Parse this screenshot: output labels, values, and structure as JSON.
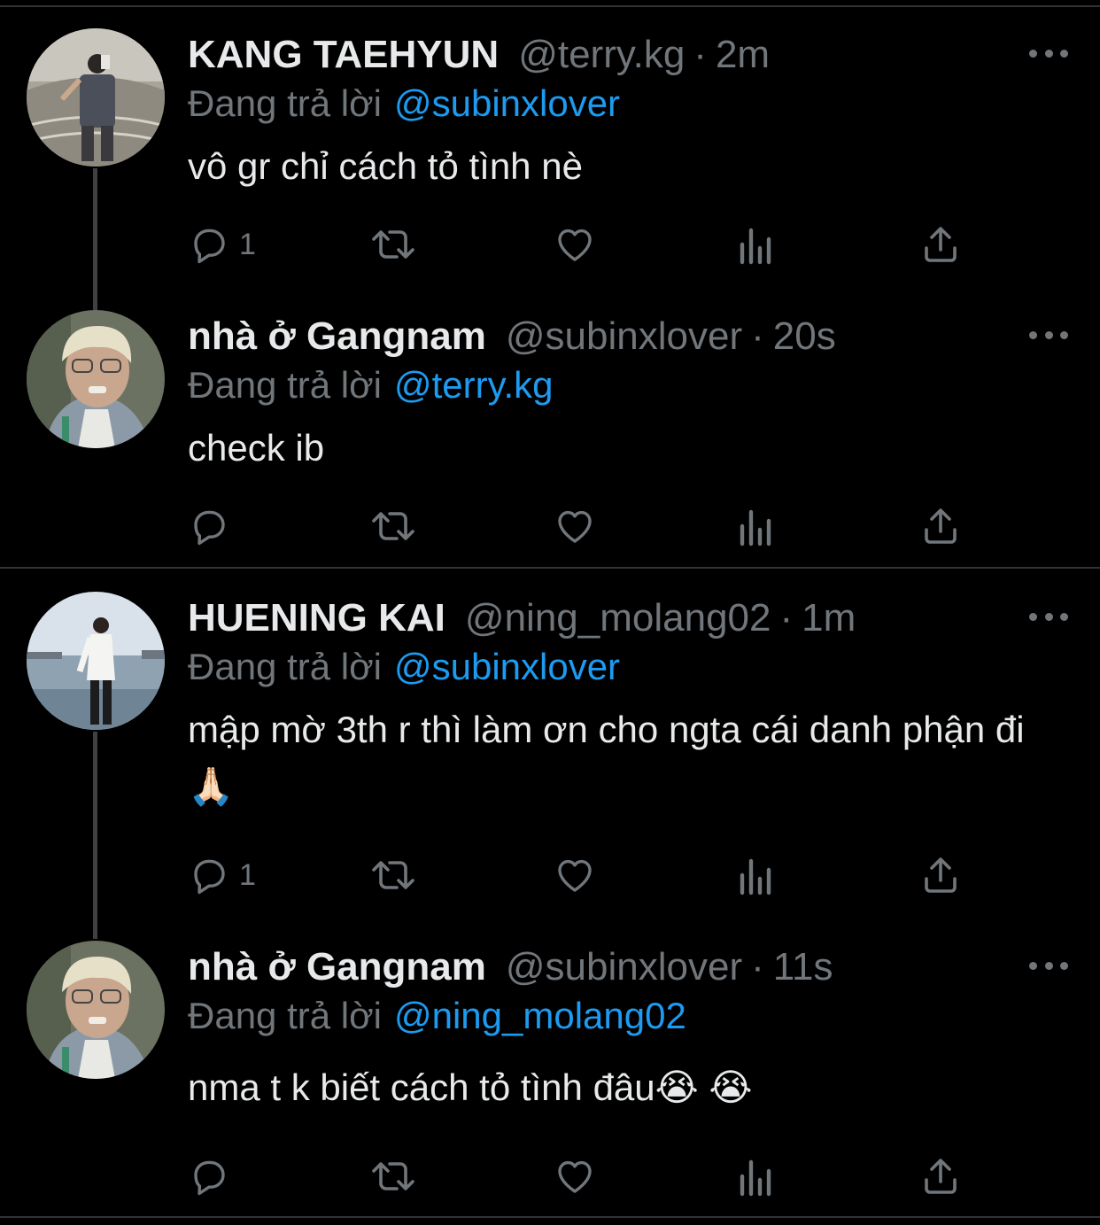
{
  "tweets": [
    {
      "name": "KANG TAEHYUN",
      "handle": "@terry.kg",
      "separator": "·",
      "time": "2m",
      "replying_prefix": "Đang trả lời",
      "replying_to": "@subinxlover",
      "text": "vô gr chỉ cách tỏ tình nè",
      "reply_count": "1",
      "avatar": "photo-man-mirror-selfie"
    },
    {
      "name": "nhà ở Gangnam",
      "handle": "@subinxlover",
      "separator": "·",
      "time": "20s",
      "replying_prefix": "Đang trả lời",
      "replying_to": "@terry.kg",
      "text": "check ib",
      "reply_count": "",
      "avatar": "photo-blonde-glasses"
    },
    {
      "name": "HUENING KAI",
      "handle": "@ning_molang02",
      "separator": "·",
      "time": "1m",
      "replying_prefix": "Đang trả lời",
      "replying_to": "@subinxlover",
      "text": "mập mờ 3th r thì làm ơn cho ngta cái danh phận đi🙏🏻",
      "reply_count": "1",
      "avatar": "photo-beach-man"
    },
    {
      "name": "nhà ở Gangnam",
      "handle": "@subinxlover",
      "separator": "·",
      "time": "11s",
      "replying_prefix": "Đang trả lời",
      "replying_to": "@ning_molang02",
      "text": "nma t k biết cách tỏ tình đâu😭 😭",
      "reply_count": "",
      "avatar": "photo-blonde-glasses"
    }
  ],
  "icons": [
    "reply-icon",
    "retweet-icon",
    "like-icon",
    "analytics-icon",
    "share-icon",
    "more-icon"
  ],
  "colors": {
    "background": "#000000",
    "text": "#e7e9ea",
    "secondary": "#71767b",
    "mention": "#1d9bf0",
    "divider": "#2f3336"
  }
}
